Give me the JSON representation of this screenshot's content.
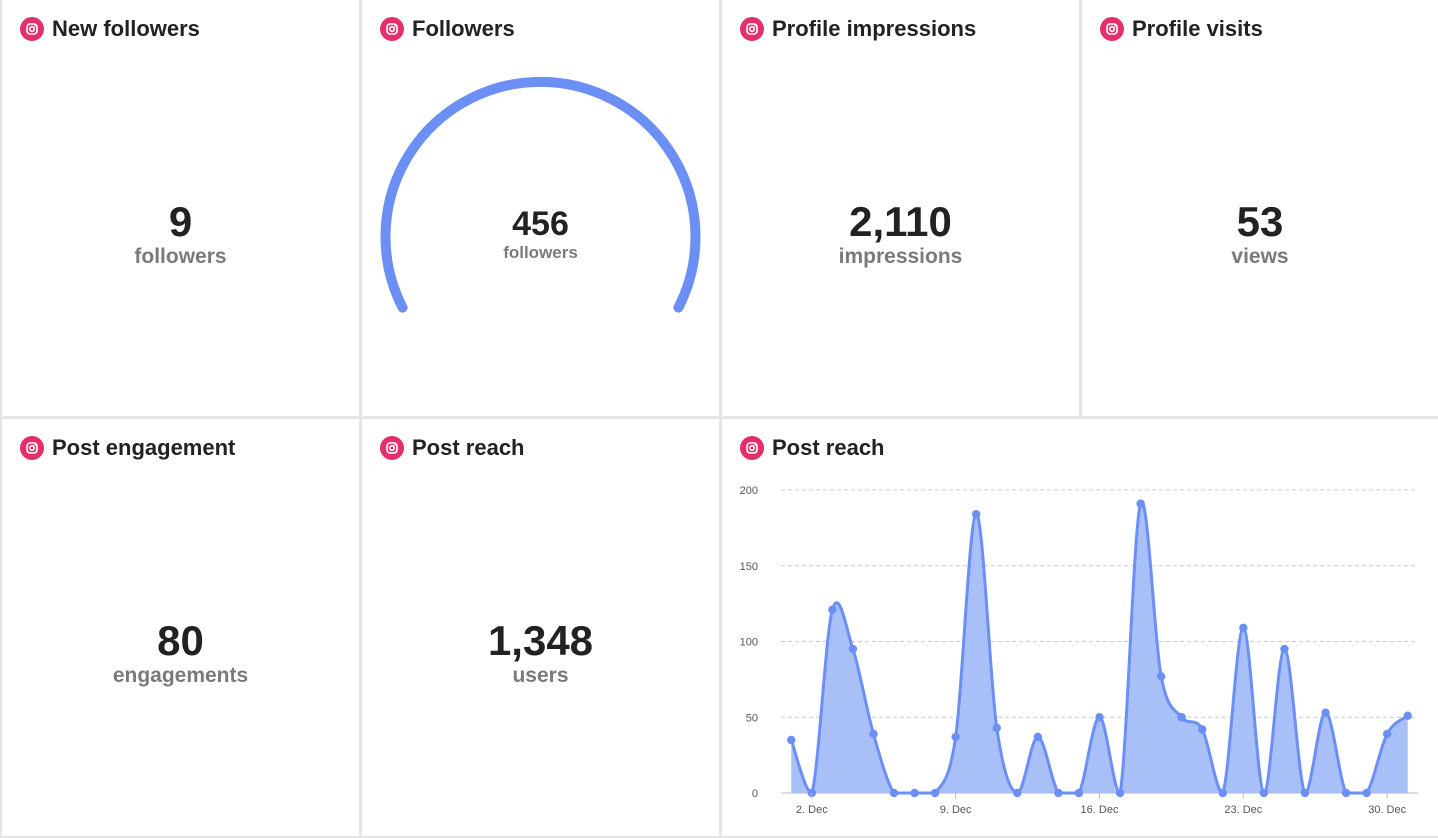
{
  "colors": {
    "accent": "#6b8ff5",
    "instagram": "#e1306c",
    "area_fill": "#a3bdf7"
  },
  "icon": "instagram-icon",
  "cards": {
    "new_followers": {
      "title": "New followers",
      "value": "9",
      "unit": "followers"
    },
    "followers": {
      "title": "Followers",
      "value": "456",
      "unit": "followers"
    },
    "profile_impressions": {
      "title": "Profile impressions",
      "value": "2,110",
      "unit": "impressions"
    },
    "profile_visits": {
      "title": "Profile visits",
      "value": "53",
      "unit": "views"
    },
    "post_engagement": {
      "title": "Post engagement",
      "value": "80",
      "unit": "engagements"
    },
    "post_reach": {
      "title": "Post reach",
      "value": "1,348",
      "unit": "users"
    },
    "post_reach_chart": {
      "title": "Post reach"
    }
  },
  "chart_data": {
    "type": "area",
    "title": "Post reach",
    "x": [
      "1 Dec",
      "2 Dec",
      "3 Dec",
      "4 Dec",
      "5 Dec",
      "6 Dec",
      "7 Dec",
      "8 Dec",
      "9 Dec",
      "10 Dec",
      "11 Dec",
      "12 Dec",
      "13 Dec",
      "14 Dec",
      "15 Dec",
      "16 Dec",
      "17 Dec",
      "18 Dec",
      "19 Dec",
      "20 Dec",
      "21 Dec",
      "22 Dec",
      "23 Dec",
      "24 Dec",
      "25 Dec",
      "26 Dec",
      "27 Dec",
      "28 Dec",
      "29 Dec",
      "30 Dec",
      "31 Dec"
    ],
    "values": [
      35,
      0,
      121,
      95,
      39,
      0,
      0,
      0,
      37,
      184,
      43,
      0,
      37,
      0,
      0,
      50,
      0,
      191,
      77,
      50,
      42,
      0,
      109,
      0,
      95,
      0,
      53,
      0,
      0,
      39,
      51
    ],
    "x_tick_labels": [
      "2. Dec",
      "9. Dec",
      "16. Dec",
      "23. Dec",
      "30. Dec"
    ],
    "y_ticks": [
      0,
      50,
      100,
      150,
      200
    ],
    "ylim": [
      0,
      200
    ],
    "grid": true,
    "legend": "none"
  }
}
